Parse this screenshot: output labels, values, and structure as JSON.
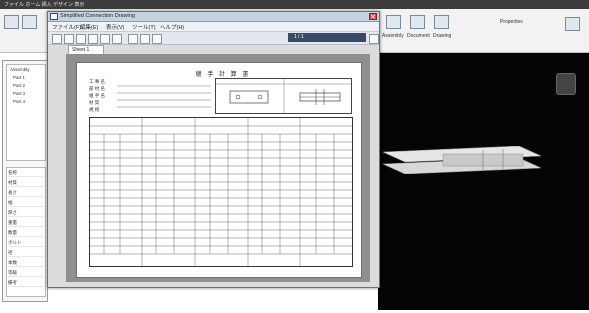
{
  "app": {
    "titlebar_text": "ファイル ホーム 挿入 デザイン 表示",
    "ribbon_right_items": [
      "Assembly",
      "Document",
      "Drawing",
      "Properties"
    ]
  },
  "preview_window": {
    "title": "Simplified Connection Drawing",
    "menu": [
      "ファイル(F)",
      "編集(E)",
      "表示(V)",
      "ツール(T)",
      "ヘルプ(H)"
    ],
    "page_indicator": "1 / 1",
    "tab_label": "Sheet 1"
  },
  "document": {
    "title": "継 手 計 算 書",
    "info_lines": [
      "工 事 名",
      "部 材 名",
      "継 手 名",
      "材 質",
      "規 格"
    ]
  },
  "left_panel": {
    "tree_items": [
      "Assembly",
      "Part 1",
      "Part 2",
      "Part 3",
      "Part 4"
    ],
    "property_rows": [
      "名称",
      "材質",
      "長さ",
      "幅",
      "厚さ",
      "重量",
      "数量",
      "ボルト",
      "径",
      "本数",
      "等級",
      "備考"
    ]
  },
  "colors": {
    "viewport_bg": "#050505",
    "shape_fill": "#dedede",
    "shape_stroke": "#9a9a9a"
  }
}
